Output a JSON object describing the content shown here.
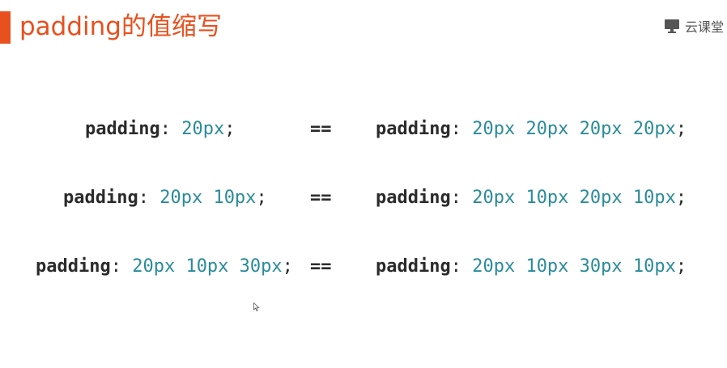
{
  "slide": {
    "title": "padding的值缩写",
    "brand": "云课堂",
    "accent_color": "#e8501e",
    "value_color": "#2a8b9a",
    "brand_icon": "screen-icon"
  },
  "rows": [
    {
      "left": {
        "prop": "padding",
        "colon": ":",
        "values": "20px",
        "semicolon": ";"
      },
      "equals": "==",
      "right": {
        "prop": "padding",
        "colon": ":",
        "values": "20px 20px 20px 20px",
        "semicolon": ";"
      }
    },
    {
      "left": {
        "prop": "padding",
        "colon": ":",
        "values": "20px 10px",
        "semicolon": ";"
      },
      "equals": "==",
      "right": {
        "prop": "padding",
        "colon": ":",
        "values": "20px 10px 20px 10px",
        "semicolon": ";"
      }
    },
    {
      "left": {
        "prop": "padding",
        "colon": ":",
        "values": "20px 10px 30px",
        "semicolon": ";"
      },
      "equals": "==",
      "right": {
        "prop": "padding",
        "colon": ":",
        "values": "20px 10px 30px 10px",
        "semicolon": ";"
      }
    }
  ]
}
